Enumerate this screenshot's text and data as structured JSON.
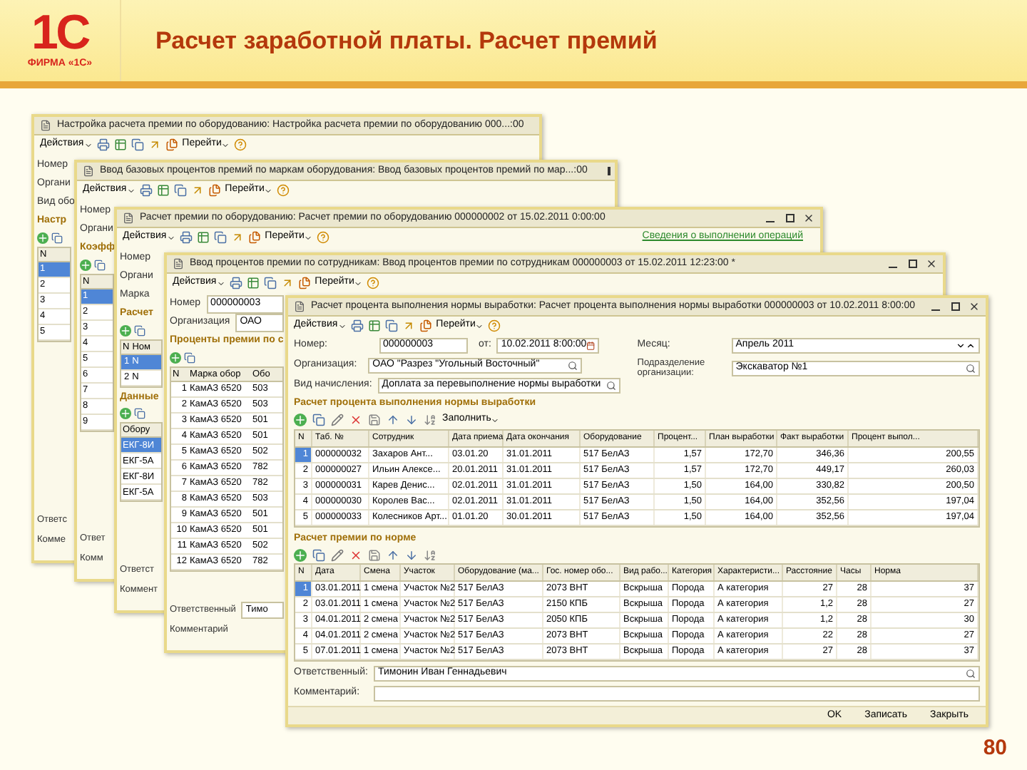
{
  "slide": {
    "logo_mark": "1С",
    "logo_caption": "ФИРМА «1С»",
    "title": "Расчет заработной платы.  Расчет премий",
    "page_number": "80"
  },
  "windows": [
    {
      "title": "Настройка расчета премии по оборудованию: Настройка расчета премии по оборудованию 000...:00",
      "actions": "Действия",
      "goto": "Перейти",
      "fields": [
        {
          "label": "Номер"
        },
        {
          "label": "Органи"
        },
        {
          "label": "Вид обо"
        }
      ],
      "tables": [
        {
          "title": "Настр",
          "header": [
            "N"
          ],
          "rows": [
            {
              "cells": [
                "1"
              ],
              "selected": true
            },
            {
              "cells": [
                "2"
              ],
              "selected": false
            },
            {
              "cells": [
                "3"
              ],
              "selected": false
            },
            {
              "cells": [
                "4"
              ],
              "selected": false
            },
            {
              "cells": [
                "5"
              ],
              "selected": false
            }
          ]
        }
      ],
      "footer": [
        {
          "label": "Ответс"
        },
        {
          "label": "Комме"
        }
      ]
    },
    {
      "title": "Ввод базовых процентов премий по маркам оборудования: Ввод базовых процентов премий по мар...:00",
      "actions": "Действия",
      "goto": "Перейти",
      "fields": [
        {
          "label": "Номер"
        },
        {
          "label": "Органи"
        }
      ],
      "tables": [
        {
          "title": "Коэфф",
          "header": [
            "N"
          ],
          "rows": [
            {
              "cells": [
                "1"
              ],
              "selected": true
            },
            {
              "cells": [
                "2"
              ],
              "selected": false
            },
            {
              "cells": [
                "3"
              ],
              "selected": false
            },
            {
              "cells": [
                "4"
              ],
              "selected": false
            },
            {
              "cells": [
                "5"
              ],
              "selected": false
            },
            {
              "cells": [
                "6"
              ],
              "selected": false
            },
            {
              "cells": [
                "7"
              ],
              "selected": false
            },
            {
              "cells": [
                "8"
              ],
              "selected": false
            },
            {
              "cells": [
                "9"
              ],
              "selected": false
            }
          ]
        }
      ],
      "footer": [
        {
          "label": "Ответ"
        },
        {
          "label": "Комм"
        }
      ]
    },
    {
      "title": "Расчет премии по оборудованию: Расчет премии по оборудованию 000000002 от 15.02.2011 0:00:00",
      "actions": "Действия",
      "goto": "Перейти",
      "link": "Сведения о выполнении операций",
      "fields": [
        {
          "label": "Номер"
        },
        {
          "label": "Органи"
        },
        {
          "label": "Марка"
        }
      ],
      "tables": [
        {
          "title": "Расчет",
          "header": [
            "N",
            "Ном"
          ],
          "rows": [
            {
              "cells": [
                "1",
                "N"
              ],
              "selected": true
            },
            {
              "cells": [
                "2",
                "N"
              ],
              "selected": false
            }
          ]
        },
        {
          "title": "Данные",
          "header": [
            "Обору"
          ],
          "rows": [
            {
              "cells": [
                "ЕКГ-8И"
              ],
              "selected": true
            },
            {
              "cells": [
                "ЕКГ-5А"
              ],
              "selected": false
            },
            {
              "cells": [
                "ЕКГ-8И"
              ],
              "selected": false
            },
            {
              "cells": [
                "ЕКГ-5А"
              ],
              "selected": false
            }
          ]
        }
      ],
      "footer": [
        {
          "label": "Ответст"
        },
        {
          "label": "Коммент"
        }
      ]
    },
    {
      "title": "Ввод процентов премии по сотрудникам: Ввод процентов премии по сотрудникам 000000003 от 15.02.2011 12:23:00 *",
      "actions": "Действия",
      "goto": "Перейти",
      "fields": [
        {
          "label": "Номер",
          "value": "000000003"
        },
        {
          "label": "Организация",
          "value": "ОАО"
        }
      ],
      "tables": [
        {
          "title": "Проценты премии по с",
          "header": [
            "N",
            "Марка обор",
            "Обо"
          ],
          "rows": [
            {
              "cells": [
                "1",
                "КамАЗ 6520",
                "503"
              ],
              "selected": false
            },
            {
              "cells": [
                "2",
                "КамАЗ 6520",
                "503"
              ],
              "selected": false
            },
            {
              "cells": [
                "3",
                "КамАЗ 6520",
                "501"
              ],
              "selected": false
            },
            {
              "cells": [
                "4",
                "КамАЗ 6520",
                "501"
              ],
              "selected": false
            },
            {
              "cells": [
                "5",
                "КамАЗ 6520",
                "502"
              ],
              "selected": false
            },
            {
              "cells": [
                "6",
                "КамАЗ 6520",
                "782"
              ],
              "selected": false
            },
            {
              "cells": [
                "7",
                "КамАЗ 6520",
                "782"
              ],
              "selected": false
            },
            {
              "cells": [
                "8",
                "КамАЗ 6520",
                "503"
              ],
              "selected": false
            },
            {
              "cells": [
                "9",
                "КамАЗ 6520",
                "501"
              ],
              "selected": false
            },
            {
              "cells": [
                "10",
                "КамАЗ 6520",
                "501"
              ],
              "selected": false
            },
            {
              "cells": [
                "11",
                "КамАЗ 6520",
                "502"
              ],
              "selected": false
            },
            {
              "cells": [
                "12",
                "КамАЗ 6520",
                "782"
              ],
              "selected": false
            }
          ]
        }
      ],
      "footer": [
        {
          "label": "Ответственный",
          "value": "Тимо"
        },
        {
          "label": "Комментарий"
        }
      ]
    }
  ],
  "front": {
    "title": "Расчет процента выполнения нормы выработки: Расчет процента выполнения нормы выработки 000000003 от 10.02.2011 8:00:00",
    "actions": "Действия",
    "goto": "Перейти",
    "number": {
      "label": "Номер:",
      "value": "000000003"
    },
    "date": {
      "label": "от:",
      "value": "10.02.2011 8:00:00"
    },
    "month": {
      "label": "Месяц:",
      "value": "Апрель 2011"
    },
    "organization": {
      "label": "Организация:",
      "value": "ОАО \"Разрез \"Угольный Восточный\""
    },
    "department": {
      "label": "Подразделение организации:",
      "value": "Экскаватор №1"
    },
    "accrual": {
      "label": "Вид начисления:",
      "value": "Доплата за перевыполнение нормы выработки"
    },
    "table1": {
      "title": "Расчет процента выполнения нормы выработки",
      "fill": "Заполнить",
      "columns": [
        "N",
        "Таб. №",
        "Сотрудник",
        "Дата приема",
        "Дата окончания",
        "Оборудование",
        "Процент...",
        "План выработки",
        "Факт выработки",
        "Процент выпол..."
      ],
      "rows": [
        {
          "selected": true,
          "cells": [
            "1",
            "000000032",
            "Захаров Ант...",
            "03.01.20",
            "31.01.2011",
            "517 БелАЗ",
            "1,57",
            "172,70",
            "346,36",
            "200,55"
          ]
        },
        {
          "selected": false,
          "cells": [
            "2",
            "000000027",
            "Ильин Алексе...",
            "20.01.2011",
            "31.01.2011",
            "517 БелАЗ",
            "1,57",
            "172,70",
            "449,17",
            "260,03"
          ]
        },
        {
          "selected": false,
          "cells": [
            "3",
            "000000031",
            "Карев Денис...",
            "02.01.2011",
            "31.01.2011",
            "517 БелАЗ",
            "1,50",
            "164,00",
            "330,82",
            "200,50"
          ]
        },
        {
          "selected": false,
          "cells": [
            "4",
            "000000030",
            "Королев Вас...",
            "02.01.2011",
            "31.01.2011",
            "517 БелАЗ",
            "1,50",
            "164,00",
            "352,56",
            "197,04"
          ]
        },
        {
          "selected": false,
          "cells": [
            "5",
            "000000033",
            "Колесников Арт...",
            "01.01.20",
            "30.01.2011",
            "517 БелАЗ",
            "1,50",
            "164,00",
            "352,56",
            "197,04"
          ]
        }
      ]
    },
    "table2": {
      "title": "Расчет премии по норме",
      "columns": [
        "N",
        "Дата",
        "Смена",
        "Участок",
        "Оборудование (ма...",
        "Гос. номер обо...",
        "Вид рабо...",
        "Категория",
        "Характеристи...",
        "Расстояние",
        "Часы",
        "Норма"
      ],
      "rows": [
        {
          "selected": true,
          "cells": [
            "1",
            "03.01.2011",
            "1 смена",
            "Участок №2",
            "517 БелАЗ",
            "2073 ВНТ",
            "Вскрыша",
            "Порода",
            "А категория",
            "27",
            "28",
            "37"
          ]
        },
        {
          "selected": false,
          "cells": [
            "2",
            "03.01.2011",
            "1 смена",
            "Участок №2",
            "517 БелАЗ",
            "2150 КПБ",
            "Вскрыша",
            "Порода",
            "А категория",
            "1,2",
            "28",
            "27"
          ]
        },
        {
          "selected": false,
          "cells": [
            "3",
            "04.01.2011",
            "2 смена",
            "Участок №2",
            "517 БелАЗ",
            "2050 КПБ",
            "Вскрыша",
            "Порода",
            "А категория",
            "1,2",
            "28",
            "30"
          ]
        },
        {
          "selected": false,
          "cells": [
            "4",
            "04.01.2011",
            "2 смена",
            "Участок №2",
            "517 БелАЗ",
            "2073 ВНТ",
            "Вскрыша",
            "Порода",
            "А категория",
            "22",
            "28",
            "27"
          ]
        },
        {
          "selected": false,
          "cells": [
            "5",
            "07.01.2011",
            "1 смена",
            "Участок №2",
            "517 БелАЗ",
            "2073 ВНТ",
            "Вскрыша",
            "Порода",
            "А категория",
            "27",
            "28",
            "37"
          ]
        }
      ]
    },
    "responsible": {
      "label": "Ответственный:",
      "value": "Тимонин Иван Геннадьевич"
    },
    "comment": {
      "label": "Комментарий:"
    },
    "buttons": [
      "OK",
      "Записать",
      "Закрыть"
    ]
  }
}
